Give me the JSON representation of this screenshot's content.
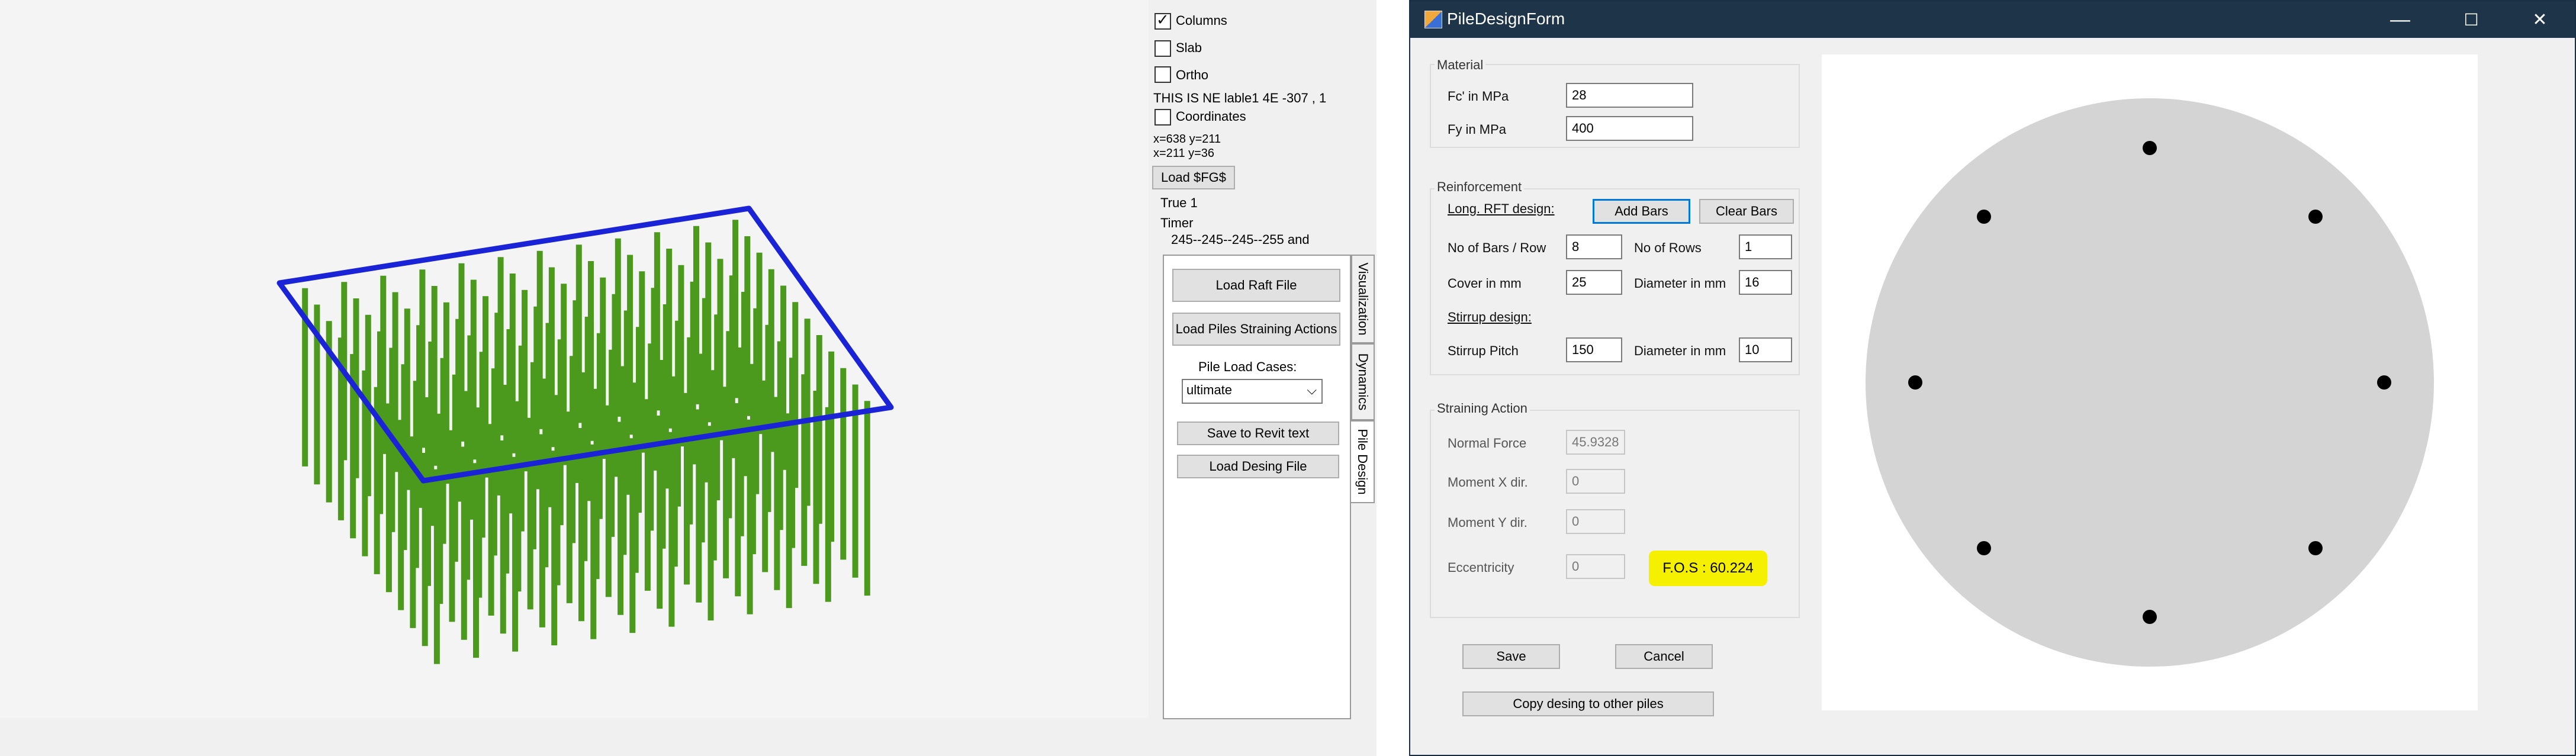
{
  "left_app": {
    "checkboxes": [
      {
        "label": "Columns",
        "checked": true
      },
      {
        "label": "Slab",
        "checked": false
      },
      {
        "label": "Ortho",
        "checked": false
      },
      {
        "label": "Coordinates",
        "checked": false
      }
    ],
    "info_line": "THIS IS NE lable1 4E -307 , 1",
    "coords_1": "x=638 y=211",
    "coords_2": "x=211 y=36",
    "load_button": "Load $FG$",
    "status_true": "True 1",
    "timer_label": "Timer",
    "timer_values": "245--245--245--255 and",
    "tabs": [
      "Visualization",
      "Dynamics",
      "Pile Design"
    ],
    "buttons": {
      "load_raft": "Load Raft File",
      "load_piles": "Load Piles Straining Actions",
      "save_revit": "Save to Revit text",
      "load_desing": "Load Desing File"
    },
    "pile_load_cases_label": "Pile Load Cases:",
    "pile_load_cases_value": "ultimate",
    "colors": {
      "columns": "#4b9a1e",
      "slab_outline": "#1a24d6"
    }
  },
  "form": {
    "title": "PileDesignForm",
    "window_buttons": {
      "minimize": "—",
      "maximize": "☐",
      "close": "✕"
    },
    "material": {
      "title": "Material",
      "fc_label": "Fc' in MPa",
      "fc_value": "28",
      "fy_label": "Fy in MPa",
      "fy_value": "400"
    },
    "reinforcement": {
      "title": "Reinforcement",
      "long_label": "Long. RFT design:",
      "add_bars": "Add Bars",
      "clear_bars": "Clear Bars",
      "bars_row_label": "No of Bars / Row",
      "bars_row_value": "8",
      "rows_label": "No of Rows",
      "rows_value": "1",
      "cover_label": "Cover in mm",
      "cover_value": "25",
      "dia_label": "Diameter in mm",
      "dia_value": "16",
      "stirrup_label": "Stirrup design:",
      "pitch_label": "Stirrup Pitch",
      "pitch_value": "150",
      "stirrup_dia_label": "Diameter in mm",
      "stirrup_dia_value": "10"
    },
    "straining": {
      "title": "Straining Action",
      "normal_label": "Normal Force",
      "normal_value": "45.9328",
      "mx_label": "Moment X dir.",
      "mx_value": "0",
      "my_label": "Moment Y dir.",
      "my_value": "0",
      "ecc_label": "Eccentricity",
      "ecc_value": "0",
      "fos": "F.O.S : 60.224"
    },
    "buttons": {
      "save": "Save",
      "cancel": "Cancel",
      "copy": "Copy desing to other piles"
    },
    "colors": {
      "section_fill": "#d4d4d4",
      "bar": "#000000",
      "highlight": "#f5f000"
    }
  }
}
